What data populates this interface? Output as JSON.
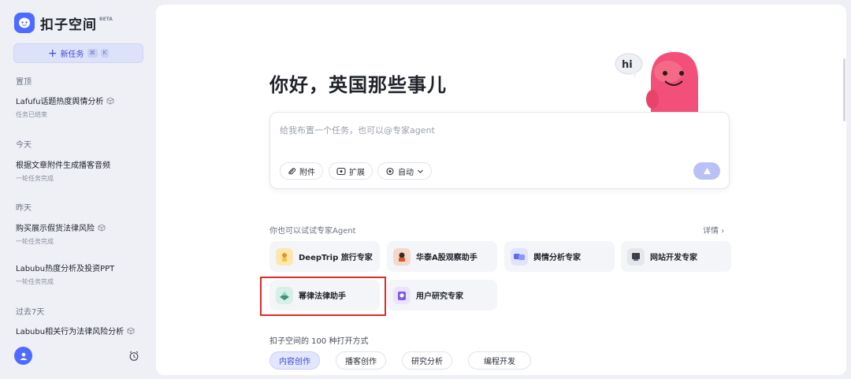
{
  "app": {
    "name": "扣子空间",
    "badge": "BETA"
  },
  "sidebar": {
    "new_task": {
      "label": "新任务",
      "kbd1": "⌘",
      "kbd2": "K"
    },
    "sections": [
      {
        "title": "置顶",
        "tasks": [
          {
            "title": "Lafufu话题热度舆情分析",
            "status": "任务已结束"
          }
        ]
      },
      {
        "title": "今天",
        "tasks": [
          {
            "title": "根据文章附件生成播客音频",
            "status": "一轮任务完成"
          }
        ]
      },
      {
        "title": "昨天",
        "tasks": [
          {
            "title": "购买展示假货法律风险",
            "status": "一轮任务完成"
          },
          {
            "title": "Labubu热度分析及投资PPT",
            "status": "一轮任务完成"
          }
        ]
      },
      {
        "title": "过去7天",
        "tasks": [
          {
            "title": "Labubu相关行为法律风险分析",
            "status": ""
          }
        ]
      }
    ]
  },
  "main": {
    "greeting": "你好，英国那些事儿",
    "mascot_bubble": "hi",
    "input_placeholder": "给我布置一个任务，也可以@专家agent",
    "chips": {
      "attach": "附件",
      "extend": "扩展",
      "auto": "自动"
    },
    "try_label": "你也可以试试专家Agent",
    "detail_label": "详情",
    "agents": [
      {
        "name": "DeepTrip 旅行专家",
        "color": "#f6c343"
      },
      {
        "name": "华泰A股观察助手",
        "color": "#d9572b"
      },
      {
        "name": "舆情分析专家",
        "color": "#5b6bf5"
      },
      {
        "name": "网站开发专家",
        "color": "#3a3f4a"
      },
      {
        "name": "幂律法律助手",
        "color": "#3f8f7a"
      },
      {
        "name": "用户研究专家",
        "color": "#7b5ce6"
      }
    ],
    "ways_label": "扣子空间的 100 种打开方式",
    "tabs": [
      "内容创作",
      "播客创作",
      "研究分析",
      "编程开发"
    ],
    "active_tab": "内容创作"
  }
}
